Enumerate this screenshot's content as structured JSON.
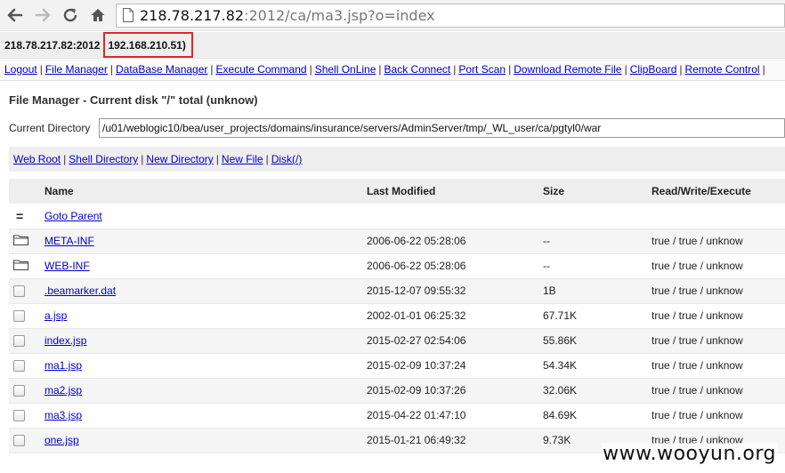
{
  "browser": {
    "url_host": "218.78.217.82",
    "url_path": ":2012/ca/ma3.jsp?o=index"
  },
  "hostbar": {
    "host": "218.78.217.82:2012",
    "internal_ip": "192.168.210.51)"
  },
  "menu": {
    "items": [
      "Logout",
      "File Manager",
      "DataBase Manager",
      "Execute Command",
      "Shell OnLine",
      "Back Connect",
      "Port Scan",
      "Download Remote File",
      "ClipBoard",
      "Remote Control"
    ],
    "separator": "|"
  },
  "heading": "File Manager - Current disk \"/\" total (unknow)",
  "current_dir": {
    "label": "Current Directory",
    "value": "/u01/weblogic10/bea/user_projects/domains/insurance/servers/AdminServer/tmp/_WL_user/ca/pgtyl0/war"
  },
  "links": {
    "items": [
      "Web Root",
      "Shell Directory",
      "New Directory",
      "New File",
      "Disk(/)"
    ],
    "separator": "|"
  },
  "table": {
    "headers": [
      "Name",
      "Last Modified",
      "Size",
      "Read/Write/Execute"
    ],
    "parent": {
      "icon": "=",
      "label": "Goto Parent"
    },
    "rows": [
      {
        "icon": "folder-icon",
        "name": "META-INF",
        "modified": "2006-06-22 05:28:06",
        "size": "--",
        "rwx": "true / true / unknow"
      },
      {
        "icon": "folder-icon",
        "name": "WEB-INF",
        "modified": "2006-06-22 05:28:06",
        "size": "--",
        "rwx": "true / true / unknow"
      },
      {
        "icon": "checkbox",
        "name": ".beamarker.dat",
        "modified": "2015-12-07 09:55:32",
        "size": "1B",
        "rwx": "true / true / unknow"
      },
      {
        "icon": "checkbox",
        "name": "a.jsp",
        "modified": "2002-01-01 06:25:32",
        "size": "67.71K",
        "rwx": "true / true / unknow"
      },
      {
        "icon": "checkbox",
        "name": "index.jsp",
        "modified": "2015-02-27 02:54:06",
        "size": "55.86K",
        "rwx": "true / true / unknow"
      },
      {
        "icon": "checkbox",
        "name": "ma1.jsp",
        "modified": "2015-02-09 10:37:24",
        "size": "54.34K",
        "rwx": "true / true / unknow"
      },
      {
        "icon": "checkbox",
        "name": "ma2.jsp",
        "modified": "2015-02-09 10:37:26",
        "size": "32.06K",
        "rwx": "true / true / unknow"
      },
      {
        "icon": "checkbox",
        "name": "ma3.jsp",
        "modified": "2015-04-22 01:47:10",
        "size": "84.69K",
        "rwx": "true / true / unknow"
      },
      {
        "icon": "checkbox",
        "name": "one.jsp",
        "modified": "2015-01-21 06:49:32",
        "size": "9.73K",
        "rwx": "true / true / unknow"
      }
    ]
  },
  "watermark": "www.wooyun.org",
  "colors": {
    "link": "#0000cc",
    "highlight_box": "#e0262a"
  }
}
